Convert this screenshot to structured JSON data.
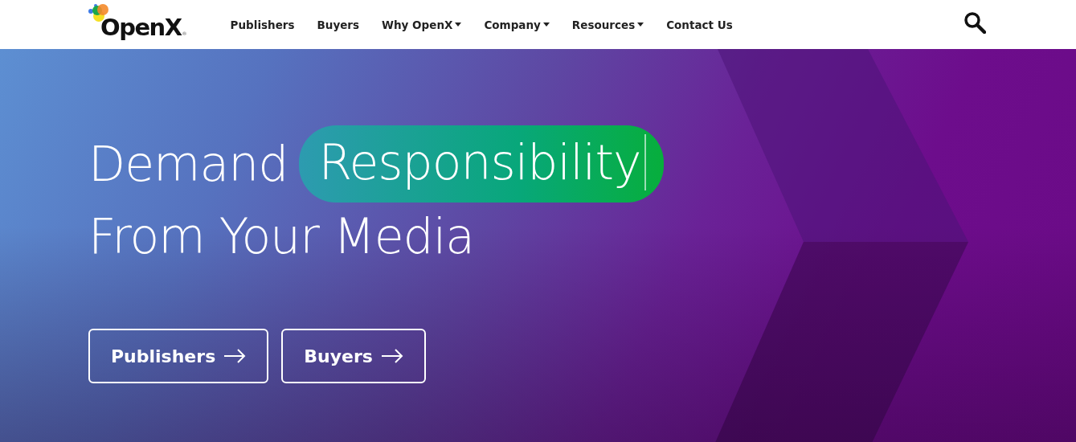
{
  "header": {
    "logo": {
      "text": "OpenX",
      "mark": "®"
    },
    "nav": [
      {
        "label": "Publishers",
        "kind": "link"
      },
      {
        "label": "Buyers",
        "kind": "link"
      },
      {
        "label": "Why OpenX",
        "kind": "dropdown"
      },
      {
        "label": "Company",
        "kind": "dropdown"
      },
      {
        "label": "Resources",
        "kind": "dropdown"
      },
      {
        "label": "Contact Us",
        "kind": "link"
      }
    ]
  },
  "hero": {
    "headline_start": "Demand",
    "highlight": "Responsibility",
    "headline_end": "From Your Media",
    "typing_cursor": true,
    "buttons": [
      {
        "label": "Publishers"
      },
      {
        "label": "Buyers"
      }
    ]
  }
}
